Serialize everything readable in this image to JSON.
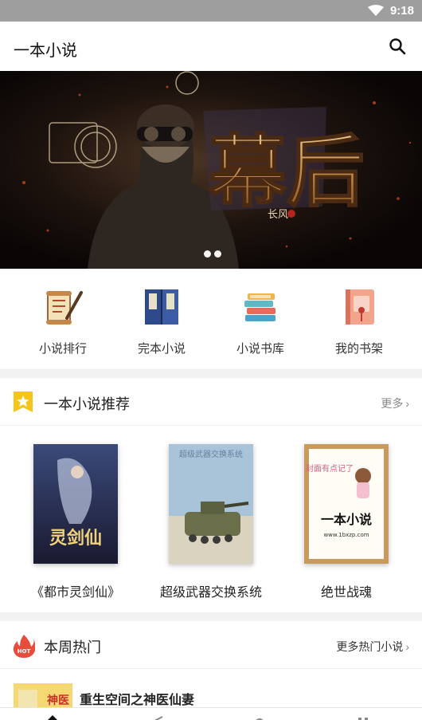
{
  "status_bar": {
    "time": "9:18",
    "wifi_icon": "wifi-icon"
  },
  "app_bar": {
    "title": "一本小说",
    "search_icon": "search-icon"
  },
  "banner": {
    "title_text": "幕后",
    "author_text": "长风",
    "page_count": 2,
    "active_page": 1
  },
  "quick_nav": [
    {
      "label": "小说排行",
      "icon": "scroll-ranking-icon"
    },
    {
      "label": "完本小说",
      "icon": "complete-book-icon"
    },
    {
      "label": "小说书库",
      "icon": "book-stack-icon"
    },
    {
      "label": "我的书架",
      "icon": "bookshelf-icon"
    }
  ],
  "recommend": {
    "title": "一本小说推荐",
    "more_label": "更多",
    "books": [
      {
        "title": "《都市灵剑仙》",
        "cover_text": "灵剑仙"
      },
      {
        "title": "超级武器交换系统",
        "cover_text": "超级武器交换系统"
      },
      {
        "title": "绝世战魂",
        "cover_text": "一本小说",
        "cover_sub": "www.1bxzp.com",
        "cover_top": "封面有点记了"
      }
    ]
  },
  "hot": {
    "title": "本周热门",
    "badge_text": "HOT",
    "more_label": "更多热门小说",
    "items": [
      {
        "title": "重生空间之神医仙妻",
        "thumb_text": "神医"
      }
    ]
  },
  "colors": {
    "accent_yellow": "#f5c518",
    "hot_red": "#e84c3d",
    "banner_gold": "#d9a860"
  }
}
